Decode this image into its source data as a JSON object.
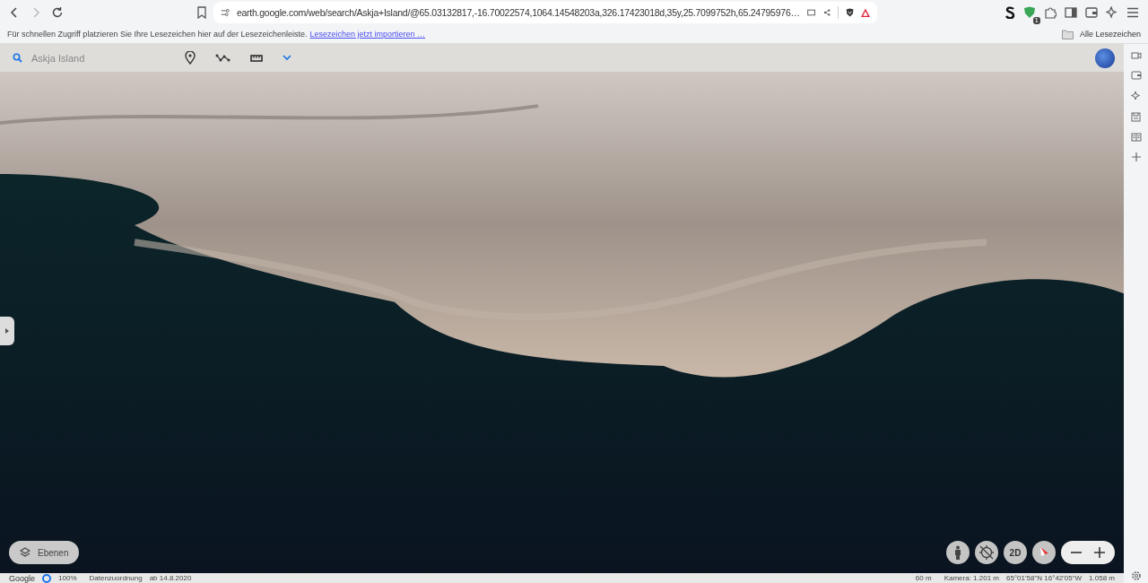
{
  "browser": {
    "url": "earth.google.com/web/search/Askja+Island/@65.03132817,-16.70022574,1064.14548203a,326.17423018d,35y,25.7099752h,65.24795976…",
    "extension_badge": "1"
  },
  "bookmarks_bar": {
    "hint": "Für schnellen Zugriff platzieren Sie Ihre Lesezeichen hier auf der Lesezeichenleiste.",
    "import_link": "Lesezeichen jetzt importieren …",
    "all_bookmarks": "Alle Lesezeichen"
  },
  "earth": {
    "search": {
      "value": "Askja Island"
    },
    "layers_button": "Ebenen",
    "view_toggle": "2D",
    "status_bar": {
      "logo": "Google",
      "loading": "100%",
      "attribution_label": "Datenzuordnung",
      "attribution_date": "ab 14.8.2020",
      "scale": "60 m",
      "camera": "Kamera: 1.201 m",
      "coordinates": "65°01'58\"N 16°42'05\"W",
      "elevation": "1.058 m"
    }
  }
}
